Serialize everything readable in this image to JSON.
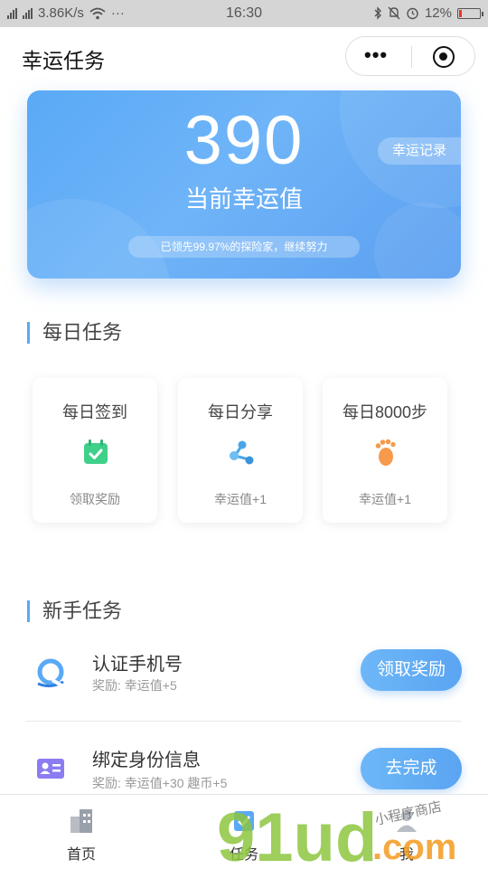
{
  "status_bar": {
    "network": "3.86K/s",
    "net_tags": [
      "2G",
      "4G"
    ],
    "time": "16:30",
    "battery": "12%",
    "more": "···"
  },
  "nav": {
    "title": "幸运任务",
    "more_icon": "more-dots-icon",
    "close_icon": "target-circle-icon"
  },
  "hero": {
    "value": "390",
    "label": "当前幸运值",
    "record_label": "幸运记录",
    "rank_text": "已领先99.97%的探险家，继续努力"
  },
  "daily": {
    "title": "每日任务",
    "cards": [
      {
        "title": "每日签到",
        "subtitle": "领取奖励",
        "icon": "calendar-check-icon",
        "color": "#3fd08a"
      },
      {
        "title": "每日分享",
        "subtitle": "幸运值+1",
        "icon": "share-nodes-icon",
        "color": "#4aa6ea"
      },
      {
        "title": "每日8000步",
        "subtitle": "幸运值+1",
        "icon": "footprint-icon",
        "color": "#f79a4b"
      }
    ]
  },
  "newbie": {
    "title": "新手任务",
    "tasks": [
      {
        "name": "认证手机号",
        "reward": "奖励:  幸运值+5",
        "button": "领取奖励",
        "icon": "phone-verify-icon"
      },
      {
        "name": "绑定身份信息",
        "reward": "奖励:  幸运值+30 趣币+5",
        "button": "去完成",
        "icon": "id-card-icon"
      }
    ]
  },
  "tabbar": {
    "items": [
      {
        "label": "首页",
        "icon": "home-building-icon"
      },
      {
        "label": "任务",
        "icon": "task-icon"
      },
      {
        "label": "我",
        "icon": "user-icon"
      }
    ]
  },
  "watermark": {
    "brand": "91ud",
    "suffix": ".com",
    "tagline": "小程序商店"
  }
}
